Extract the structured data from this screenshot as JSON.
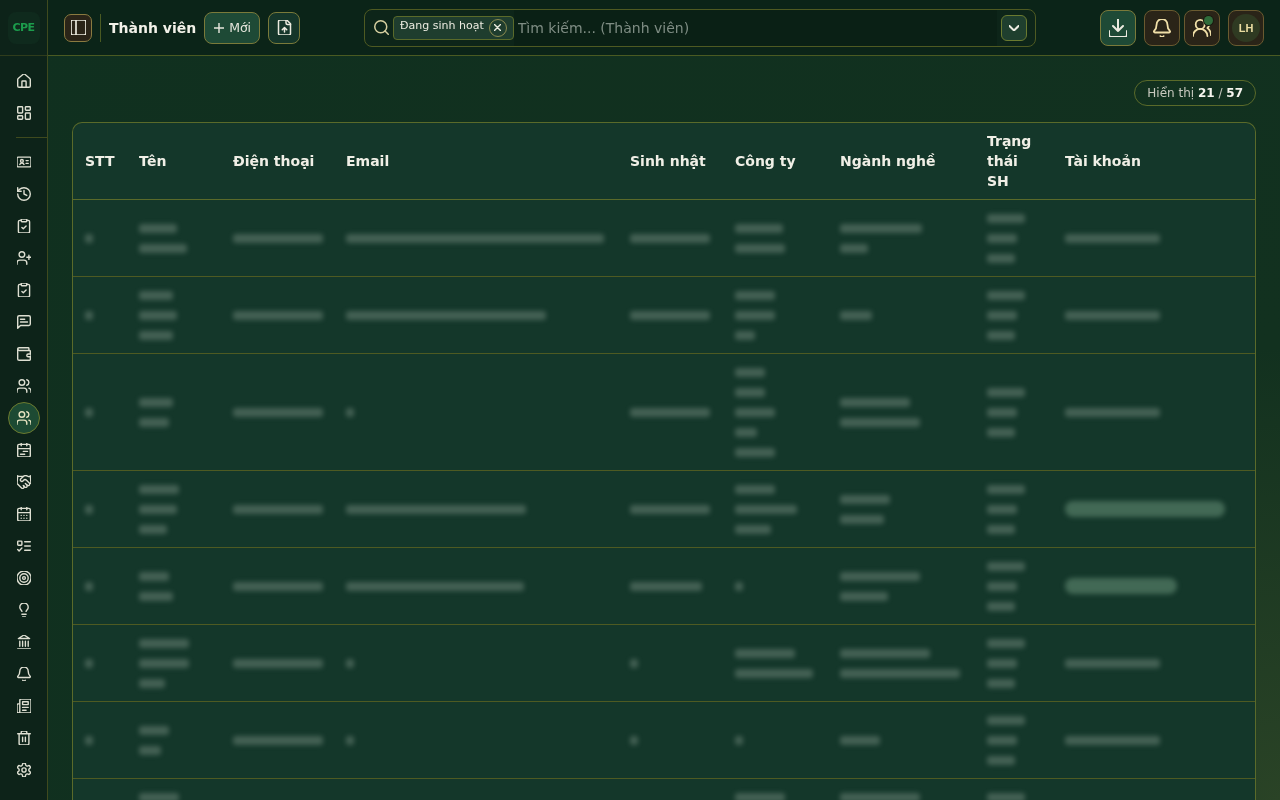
{
  "sidebar": {
    "logo": "CPE",
    "groups": [
      {
        "items": [
          {
            "selected": false
          },
          {
            "selected": false
          }
        ]
      },
      {
        "items": [
          {
            "selected": false
          },
          {
            "selected": false
          },
          {
            "selected": false
          },
          {
            "selected": false
          },
          {
            "selected": false
          },
          {
            "selected": false
          },
          {
            "selected": false
          },
          {
            "selected": false
          },
          {
            "selected": true
          },
          {
            "selected": false
          },
          {
            "selected": false
          },
          {
            "selected": false
          },
          {
            "selected": false
          },
          {
            "selected": false
          },
          {
            "selected": false
          },
          {
            "selected": false
          },
          {
            "selected": false
          },
          {
            "selected": false
          },
          {
            "selected": false
          },
          {
            "selected": false
          }
        ]
      }
    ]
  },
  "header": {
    "title": "Thành viên",
    "new_button": "Mới",
    "search": {
      "filters": [
        {
          "label": "Đang sinh hoạt"
        }
      ],
      "placeholder": "Tìm kiếm... (Thành viên)"
    },
    "members_button": {
      "unread": true
    },
    "avatar": {
      "initials": "LH"
    }
  },
  "summary": "Hiển thị **21** / **57**",
  "table": {
    "columns": [
      "STT",
      "Tên",
      "Điện thoại",
      "Email",
      "Sinh nhật",
      "Công ty",
      "Ngành nghề",
      "Trạng thái SH",
      "Tài khoản"
    ],
    "rows": [
      {
        "blurred": true
      },
      {
        "blurred": true
      },
      {
        "blurred": true
      },
      {
        "blurred": true
      },
      {
        "blurred": true
      },
      {
        "blurred": true
      },
      {
        "blurred": true
      },
      {
        "blurred": true
      }
    ]
  }
}
